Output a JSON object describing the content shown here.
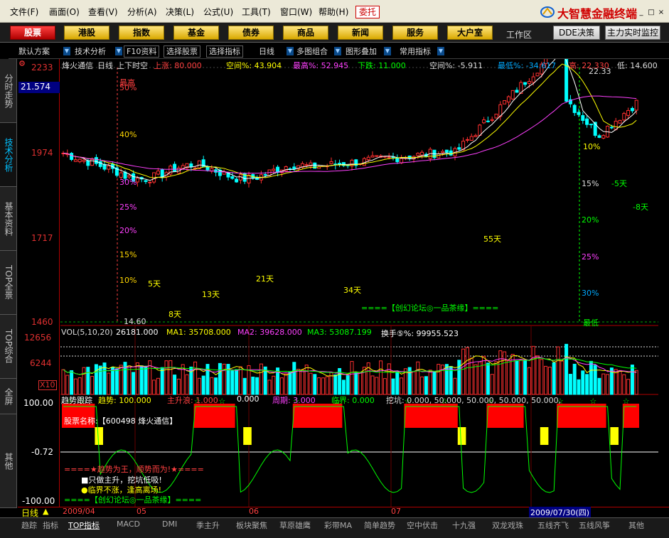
{
  "menubar": {
    "items": [
      "文件(F)",
      "画面(O)",
      "查看(V)",
      "分析(A)",
      "决策(L)",
      "公式(U)",
      "工具(T)",
      "窗口(W)",
      "帮助(H)"
    ],
    "entrust": "委托",
    "brand": "大智慧金融终端",
    "window_buttons": [
      "_",
      "□",
      "×"
    ]
  },
  "navbar": {
    "buttons": [
      "股票",
      "港股",
      "指数",
      "基金",
      "债券",
      "商品",
      "新闻",
      "服务",
      "大户室"
    ],
    "workspace": "工作区",
    "dde": "DDE决策",
    "monitor": "主力实时监控"
  },
  "toolbar": {
    "items": [
      "默认方案",
      "技术分析",
      "F10资料",
      "选择股票",
      "选择指标",
      "日线",
      "多图组合",
      "图形叠加",
      "常用指标"
    ]
  },
  "sidetabs": [
    "分时走势",
    "技术分析",
    "基本资料",
    "TOP全景",
    "TOP综合",
    "全屏",
    "其他"
  ],
  "price_axis": {
    "labels": [
      "2233",
      "1974",
      "1717",
      "1460"
    ],
    "current": "21.574",
    "vol_labels": [
      "12656",
      "6244"
    ],
    "vol_unit": "X10",
    "trend_labels": [
      "100.00",
      "-0.72",
      "-100.00"
    ]
  },
  "chart_header": {
    "stock": "烽火通信",
    "period": "日线",
    "label": "上下时空",
    "up_limit": "上涨: 80.000",
    "space_pct": "空间%: 43.904",
    "high_pct": "最高%: 52.945",
    "down": "下跌: 11.000",
    "space_pct2": "空间%: -5.911",
    "low_pct": "最低%: -34.617",
    "high": "高: 22.330",
    "low": "低: 14.600"
  },
  "chart_labels": {
    "top_mark": "最高",
    "high_value": "22.33",
    "low_value": "14.60",
    "bottom_mark": "最低",
    "forum": "====【创幻论坛◎一品茶缘】====",
    "pct_left": [
      "50%",
      "40%",
      "30%",
      "25%",
      "20%",
      "15%",
      "10%"
    ],
    "pct_right": [
      "10%",
      "15%",
      "20%",
      "25%",
      "30%"
    ],
    "days": [
      "5天",
      "8天",
      "13天",
      "21天",
      "34天",
      "55天",
      "-5天",
      "-8天"
    ]
  },
  "vol_header": {
    "name": "VOL(5,10,20)",
    "value": "26181.000",
    "ma1": "MA1: 35708.000",
    "ma2": "MA2: 39628.000",
    "ma3": "MA3: 53087.199",
    "turnover": "换手⑤%: 99955.523"
  },
  "trend_header": {
    "name": "趋势跟踪",
    "trend": "趋势: 100.000",
    "main_up": "主升浪: 1.000",
    "down": "0.000",
    "cycle": "周期: 3.000",
    "critical": "临界: 0.000",
    "dip": "挖坑: 0.000, 50.000, 50.000, 50.000, 50.000,"
  },
  "trend_labels": {
    "stock_name": "股票名称:【600498 烽火通信】",
    "motto1": "====★趋势为王，顺势而为!★====",
    "motto2": "■只做主升，挖坑低吸!",
    "motto3": "●临界不涨，逢高离场!",
    "forum2": "====【创幻论坛◎一品茶缘】===="
  },
  "timeaxis": {
    "period": "日线",
    "months": [
      "2009/04",
      "05",
      "06",
      "07"
    ],
    "date": "2009/07/30(四)"
  },
  "bottom_tabs": [
    "趋踪",
    "指标",
    "TOP指标",
    "MACD",
    "DMI",
    "季主升",
    "板块聚焦",
    "草原雄鹰",
    "彩带MA",
    "简单趋势",
    "空中伏击",
    "十九强",
    "双龙戏珠",
    "五线齐飞",
    "五线风筝",
    "其他"
  ],
  "colors": {
    "up": "#ff3030",
    "down": "#00ffff",
    "ma_white": "#ffffff",
    "ma_yellow": "#ffff00",
    "ma_magenta": "#ff40ff",
    "trend_red": "#ff0000",
    "trend_yellow": "#ffff00",
    "trend_green": "#00ff00"
  }
}
